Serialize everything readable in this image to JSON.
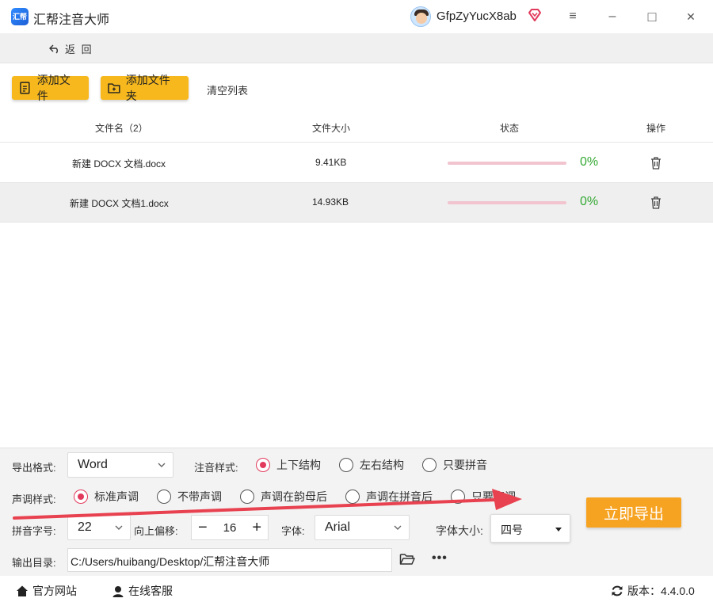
{
  "app": {
    "title": "汇帮注音大师",
    "logo_text": "汇帮"
  },
  "user": {
    "name": "GfpZyYucX8ab"
  },
  "window_controls": {
    "menu": "≡",
    "minimize": "–",
    "maximize": "□",
    "close": "✕"
  },
  "nav": {
    "back_label": "返 回"
  },
  "toolbar": {
    "add_file": "添加文件",
    "add_folder": "添加文件夹",
    "clear_list": "清空列表"
  },
  "table": {
    "headers": {
      "name": "文件名（2）",
      "size": "文件大小",
      "status": "状态",
      "action": "操作"
    },
    "rows": [
      {
        "name": "新建 DOCX 文档.docx",
        "size": "9.41KB",
        "progress": 0,
        "percent": "0%"
      },
      {
        "name": "新建 DOCX 文档1.docx",
        "size": "14.93KB",
        "progress": 0,
        "percent": "0%"
      }
    ]
  },
  "settings": {
    "format_label": "导出格式:",
    "format_value": "Word",
    "style_label": "注音样式:",
    "style_options": [
      "上下结构",
      "左右结构",
      "只要拼音"
    ],
    "style_selected": 0,
    "tone_label": "声调样式:",
    "tone_options": [
      "标准声调",
      "不带声调",
      "声调在韵母后",
      "声调在拼音后",
      "只要声调"
    ],
    "tone_selected": 0,
    "pinyin_size_label": "拼音字号:",
    "pinyin_size_value": "22",
    "offset_label": "向上偏移:",
    "offset_value": "16",
    "font_label": "字体:",
    "font_value": "Arial",
    "font_size_label": "字体大小:",
    "font_size_value": "四号",
    "output_label": "输出目录:",
    "output_path": "C:/Users/huibang/Desktop/汇帮注音大师",
    "more": "•••",
    "export_button": "立即导出"
  },
  "footer": {
    "website": "官方网站",
    "support": "在线客服",
    "version_label": "版本：4.4.0.0"
  },
  "colors": {
    "accent": "#f7b81d",
    "export": "#f7a322",
    "radio": "#e23a5c",
    "progress_track": "#f1c4cf",
    "percent": "#33a832",
    "arrow": "#e8414f"
  }
}
